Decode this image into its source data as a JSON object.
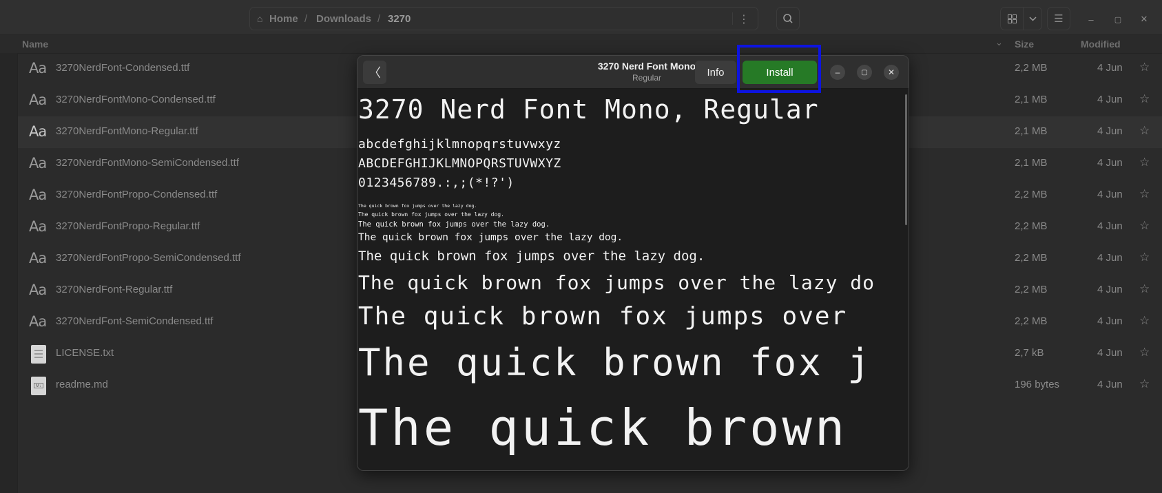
{
  "breadcrumb": {
    "home": "Home",
    "sep": "/",
    "downloads": "Downloads",
    "current": "3270"
  },
  "header_icons": {
    "menu": "⋮",
    "search": "⌕",
    "grid": "⊞",
    "chevron": "⌄",
    "list": "☰",
    "minimize": "–",
    "maximize": "▢",
    "close": "✕"
  },
  "columns": {
    "name": "Name",
    "size": "Size",
    "modified": "Modified"
  },
  "files": [
    {
      "name": "3270NerdFont-Condensed.ttf",
      "size": "2,2 MB",
      "modified": "4 Jun",
      "icon": "Aa"
    },
    {
      "name": "3270NerdFontMono-Condensed.ttf",
      "size": "2,1 MB",
      "modified": "4 Jun",
      "icon": "Aa"
    },
    {
      "name": "3270NerdFontMono-Regular.ttf",
      "size": "2,1 MB",
      "modified": "4 Jun",
      "icon": "Aa"
    },
    {
      "name": "3270NerdFontMono-SemiCondensed.ttf",
      "size": "2,1 MB",
      "modified": "4 Jun",
      "icon": "Aa"
    },
    {
      "name": "3270NerdFontPropo-Condensed.ttf",
      "size": "2,2 MB",
      "modified": "4 Jun",
      "icon": "Aa"
    },
    {
      "name": "3270NerdFontPropo-Regular.ttf",
      "size": "2,2 MB",
      "modified": "4 Jun",
      "icon": "Aa"
    },
    {
      "name": "3270NerdFontPropo-SemiCondensed.ttf",
      "size": "2,2 MB",
      "modified": "4 Jun",
      "icon": "Aa"
    },
    {
      "name": "3270NerdFont-Regular.ttf",
      "size": "2,2 MB",
      "modified": "4 Jun",
      "icon": "Aa"
    },
    {
      "name": "3270NerdFont-SemiCondensed.ttf",
      "size": "2,2 MB",
      "modified": "4 Jun",
      "icon": "Aa"
    },
    {
      "name": "LICENSE.txt",
      "size": "2,7 kB",
      "modified": "4 Jun",
      "icon": "text-file"
    },
    {
      "name": "readme.md",
      "size": "196 bytes",
      "modified": "4 Jun",
      "icon": "markdown-file"
    }
  ],
  "star": "☆",
  "dialog": {
    "title": "3270 Nerd Font Mono",
    "subtitle": "Regular",
    "back": "〈",
    "info_label": "Info",
    "install_label": "Install",
    "install_color": "#267a26",
    "highlight_color": "#0d14e0",
    "preview": {
      "heading": "3270 Nerd Font Mono, Regular",
      "lower": "abcdefghijklmnopqrstuvwxyz",
      "upper": "ABCDEFGHIJKLMNOPQRSTUVWXYZ",
      "digits": "0123456789.:,;(*!?')",
      "samples": [
        "The quick brown fox jumps over the lazy dog.",
        "The quick brown fox jumps over the lazy dog.",
        "The quick brown fox jumps over the lazy dog.",
        "The quick brown fox jumps over the lazy dog.",
        "The quick brown fox jumps over the lazy dog.",
        "The quick brown fox jumps over the lazy do",
        "The quick brown fox jumps over",
        "The quick brown fox j",
        "The quick brown"
      ]
    }
  }
}
